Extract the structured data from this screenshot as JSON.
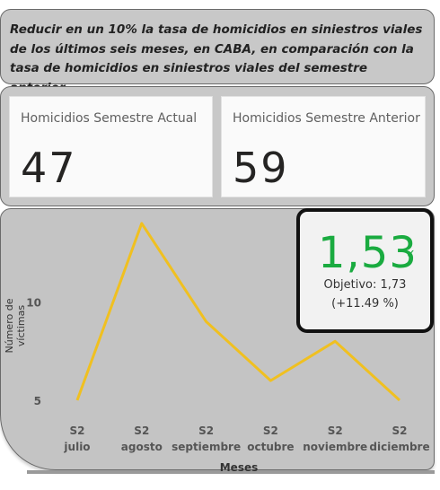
{
  "objective": {
    "text": "Reducir en un 10% la tasa de homicidios en siniestros viales de los últimos seis meses, en CABA, en comparación con la tasa de homicidios en siniestros viales del semestre anterior."
  },
  "cards": {
    "current": {
      "title": "Homicidios Semestre Actual",
      "value": "47"
    },
    "previous": {
      "title": "Homicidios Semestre Anterior",
      "value": "59"
    }
  },
  "kpi": {
    "value": "1,53",
    "check_icon": "check-icon",
    "goal": "Objetivo: 1,73",
    "delta": "(+11.49 %)",
    "color": "#1aab40"
  },
  "chart_data": {
    "type": "line",
    "categories": [
      [
        "S2",
        "julio"
      ],
      [
        "S2",
        "agosto"
      ],
      [
        "S2",
        "septiembre"
      ],
      [
        "S2",
        "octubre"
      ],
      [
        "S2",
        "noviembre"
      ],
      [
        "S2",
        "diciembre"
      ]
    ],
    "values": [
      5,
      14,
      9,
      6,
      8,
      5
    ],
    "xlabel": "Meses",
    "ylabel": "Número de víctimas",
    "yticks": [
      5,
      10
    ],
    "ylim": [
      5,
      14
    ],
    "line_color": "#f0c020",
    "grid": false
  }
}
